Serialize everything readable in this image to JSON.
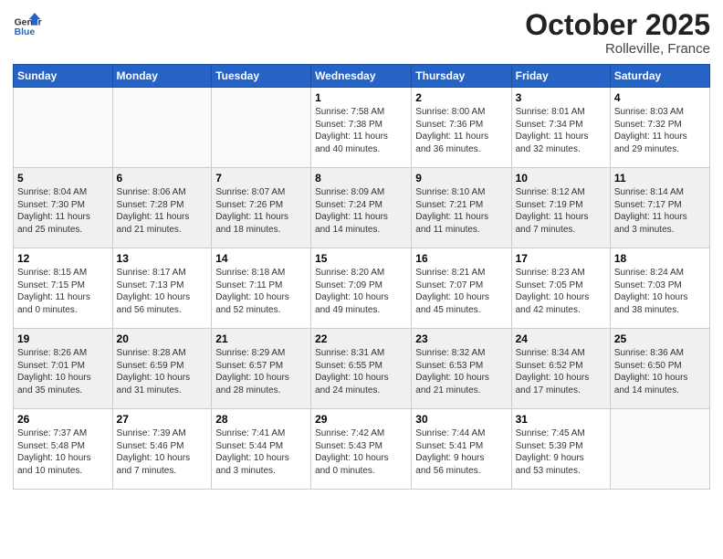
{
  "header": {
    "logo_general": "General",
    "logo_blue": "Blue",
    "month_title": "October 2025",
    "subtitle": "Rolleville, France"
  },
  "days_of_week": [
    "Sunday",
    "Monday",
    "Tuesday",
    "Wednesday",
    "Thursday",
    "Friday",
    "Saturday"
  ],
  "weeks": [
    [
      {
        "day": "",
        "info": ""
      },
      {
        "day": "",
        "info": ""
      },
      {
        "day": "",
        "info": ""
      },
      {
        "day": "1",
        "info": "Sunrise: 7:58 AM\nSunset: 7:38 PM\nDaylight: 11 hours\nand 40 minutes."
      },
      {
        "day": "2",
        "info": "Sunrise: 8:00 AM\nSunset: 7:36 PM\nDaylight: 11 hours\nand 36 minutes."
      },
      {
        "day": "3",
        "info": "Sunrise: 8:01 AM\nSunset: 7:34 PM\nDaylight: 11 hours\nand 32 minutes."
      },
      {
        "day": "4",
        "info": "Sunrise: 8:03 AM\nSunset: 7:32 PM\nDaylight: 11 hours\nand 29 minutes."
      }
    ],
    [
      {
        "day": "5",
        "info": "Sunrise: 8:04 AM\nSunset: 7:30 PM\nDaylight: 11 hours\nand 25 minutes."
      },
      {
        "day": "6",
        "info": "Sunrise: 8:06 AM\nSunset: 7:28 PM\nDaylight: 11 hours\nand 21 minutes."
      },
      {
        "day": "7",
        "info": "Sunrise: 8:07 AM\nSunset: 7:26 PM\nDaylight: 11 hours\nand 18 minutes."
      },
      {
        "day": "8",
        "info": "Sunrise: 8:09 AM\nSunset: 7:24 PM\nDaylight: 11 hours\nand 14 minutes."
      },
      {
        "day": "9",
        "info": "Sunrise: 8:10 AM\nSunset: 7:21 PM\nDaylight: 11 hours\nand 11 minutes."
      },
      {
        "day": "10",
        "info": "Sunrise: 8:12 AM\nSunset: 7:19 PM\nDaylight: 11 hours\nand 7 minutes."
      },
      {
        "day": "11",
        "info": "Sunrise: 8:14 AM\nSunset: 7:17 PM\nDaylight: 11 hours\nand 3 minutes."
      }
    ],
    [
      {
        "day": "12",
        "info": "Sunrise: 8:15 AM\nSunset: 7:15 PM\nDaylight: 11 hours\nand 0 minutes."
      },
      {
        "day": "13",
        "info": "Sunrise: 8:17 AM\nSunset: 7:13 PM\nDaylight: 10 hours\nand 56 minutes."
      },
      {
        "day": "14",
        "info": "Sunrise: 8:18 AM\nSunset: 7:11 PM\nDaylight: 10 hours\nand 52 minutes."
      },
      {
        "day": "15",
        "info": "Sunrise: 8:20 AM\nSunset: 7:09 PM\nDaylight: 10 hours\nand 49 minutes."
      },
      {
        "day": "16",
        "info": "Sunrise: 8:21 AM\nSunset: 7:07 PM\nDaylight: 10 hours\nand 45 minutes."
      },
      {
        "day": "17",
        "info": "Sunrise: 8:23 AM\nSunset: 7:05 PM\nDaylight: 10 hours\nand 42 minutes."
      },
      {
        "day": "18",
        "info": "Sunrise: 8:24 AM\nSunset: 7:03 PM\nDaylight: 10 hours\nand 38 minutes."
      }
    ],
    [
      {
        "day": "19",
        "info": "Sunrise: 8:26 AM\nSunset: 7:01 PM\nDaylight: 10 hours\nand 35 minutes."
      },
      {
        "day": "20",
        "info": "Sunrise: 8:28 AM\nSunset: 6:59 PM\nDaylight: 10 hours\nand 31 minutes."
      },
      {
        "day": "21",
        "info": "Sunrise: 8:29 AM\nSunset: 6:57 PM\nDaylight: 10 hours\nand 28 minutes."
      },
      {
        "day": "22",
        "info": "Sunrise: 8:31 AM\nSunset: 6:55 PM\nDaylight: 10 hours\nand 24 minutes."
      },
      {
        "day": "23",
        "info": "Sunrise: 8:32 AM\nSunset: 6:53 PM\nDaylight: 10 hours\nand 21 minutes."
      },
      {
        "day": "24",
        "info": "Sunrise: 8:34 AM\nSunset: 6:52 PM\nDaylight: 10 hours\nand 17 minutes."
      },
      {
        "day": "25",
        "info": "Sunrise: 8:36 AM\nSunset: 6:50 PM\nDaylight: 10 hours\nand 14 minutes."
      }
    ],
    [
      {
        "day": "26",
        "info": "Sunrise: 7:37 AM\nSunset: 5:48 PM\nDaylight: 10 hours\nand 10 minutes."
      },
      {
        "day": "27",
        "info": "Sunrise: 7:39 AM\nSunset: 5:46 PM\nDaylight: 10 hours\nand 7 minutes."
      },
      {
        "day": "28",
        "info": "Sunrise: 7:41 AM\nSunset: 5:44 PM\nDaylight: 10 hours\nand 3 minutes."
      },
      {
        "day": "29",
        "info": "Sunrise: 7:42 AM\nSunset: 5:43 PM\nDaylight: 10 hours\nand 0 minutes."
      },
      {
        "day": "30",
        "info": "Sunrise: 7:44 AM\nSunset: 5:41 PM\nDaylight: 9 hours\nand 56 minutes."
      },
      {
        "day": "31",
        "info": "Sunrise: 7:45 AM\nSunset: 5:39 PM\nDaylight: 9 hours\nand 53 minutes."
      },
      {
        "day": "",
        "info": ""
      }
    ]
  ]
}
